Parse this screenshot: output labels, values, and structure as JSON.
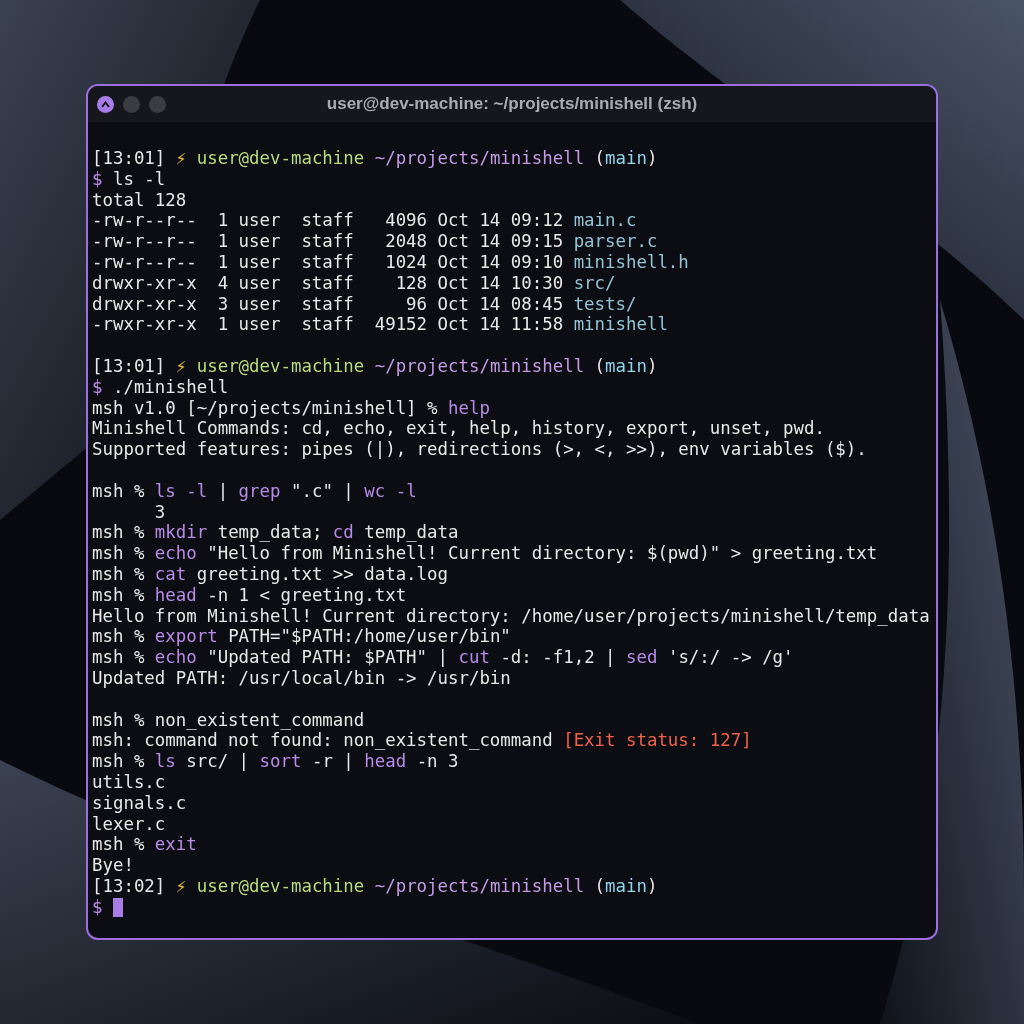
{
  "window": {
    "title": "user@dev-machine: ~/projects/minishell (zsh)"
  },
  "terminal": {
    "cursor_visible": true,
    "lines": [
      {
        "kind": "text",
        "segments": [
          {
            "t": "[13:01] ",
            "kind": "plain"
          },
          {
            "t": "⚡ ",
            "kind": "bolt"
          },
          {
            "t": "user@dev-machine ",
            "kind": "user"
          },
          {
            "t": "~/projects/minishell",
            "kind": "path"
          },
          {
            "t": " (",
            "kind": "plain"
          },
          {
            "t": "main",
            "kind": "branch"
          },
          {
            "t": ")",
            "kind": "plain"
          }
        ]
      },
      {
        "kind": "text",
        "segments": [
          {
            "t": "$ ",
            "kind": "prompt"
          },
          {
            "t": "ls -l",
            "kind": "plain"
          }
        ]
      },
      {
        "kind": "text",
        "segments": [
          {
            "t": "total 128",
            "kind": "plain"
          }
        ]
      },
      {
        "kind": "text",
        "segments": [
          {
            "t": "-rw-r--r--  1 user  staff   4096 Oct 14 09:12 ",
            "kind": "plain"
          },
          {
            "t": "main.c",
            "kind": "file"
          }
        ]
      },
      {
        "kind": "text",
        "segments": [
          {
            "t": "-rw-r--r--  1 user  staff   2048 Oct 14 09:15 ",
            "kind": "plain"
          },
          {
            "t": "parser.c",
            "kind": "file"
          }
        ]
      },
      {
        "kind": "text",
        "segments": [
          {
            "t": "-rw-r--r--  1 user  staff   1024 Oct 14 09:10 ",
            "kind": "plain"
          },
          {
            "t": "minishell.h",
            "kind": "file"
          }
        ]
      },
      {
        "kind": "text",
        "segments": [
          {
            "t": "drwxr-xr-x  4 user  staff    128 Oct 14 10:30 ",
            "kind": "plain"
          },
          {
            "t": "src/",
            "kind": "file"
          }
        ]
      },
      {
        "kind": "text",
        "segments": [
          {
            "t": "drwxr-xr-x  3 user  staff     96 Oct 14 08:45 ",
            "kind": "plain"
          },
          {
            "t": "tests/",
            "kind": "file"
          }
        ]
      },
      {
        "kind": "text",
        "segments": [
          {
            "t": "-rwxr-xr-x  1 user  staff  49152 Oct 14 11:58 ",
            "kind": "plain"
          },
          {
            "t": "minishell",
            "kind": "file"
          }
        ]
      },
      {
        "kind": "blank"
      },
      {
        "kind": "text",
        "segments": [
          {
            "t": "[13:01] ",
            "kind": "plain"
          },
          {
            "t": "⚡ ",
            "kind": "bolt"
          },
          {
            "t": "user@dev-machine ",
            "kind": "user"
          },
          {
            "t": "~/projects/minishell",
            "kind": "path"
          },
          {
            "t": " (",
            "kind": "plain"
          },
          {
            "t": "main",
            "kind": "branch"
          },
          {
            "t": ")",
            "kind": "plain"
          }
        ]
      },
      {
        "kind": "text",
        "segments": [
          {
            "t": "$ ",
            "kind": "prompt"
          },
          {
            "t": "./minishell",
            "kind": "plain"
          }
        ]
      },
      {
        "kind": "text",
        "segments": [
          {
            "t": "msh v1.0 [~/projects/minishell] % ",
            "kind": "plain"
          },
          {
            "t": "help",
            "kind": "cmd"
          }
        ]
      },
      {
        "kind": "text",
        "segments": [
          {
            "t": "Minishell Commands: cd, echo, exit, help, history, export, unset, pwd.",
            "kind": "plain"
          }
        ]
      },
      {
        "kind": "text",
        "segments": [
          {
            "t": "Supported features: pipes (|), redirections (>, <, >>), env variables ($).",
            "kind": "plain"
          }
        ]
      },
      {
        "kind": "blank"
      },
      {
        "kind": "text",
        "segments": [
          {
            "t": "msh % ",
            "kind": "plain"
          },
          {
            "t": "ls -l",
            "kind": "cmd"
          },
          {
            "t": " | ",
            "kind": "plain"
          },
          {
            "t": "grep",
            "kind": "cmd"
          },
          {
            "t": " \".c\" | ",
            "kind": "plain"
          },
          {
            "t": "wc -l",
            "kind": "cmd"
          }
        ]
      },
      {
        "kind": "text",
        "segments": [
          {
            "t": "      3",
            "kind": "plain"
          }
        ]
      },
      {
        "kind": "text",
        "segments": [
          {
            "t": "msh % ",
            "kind": "plain"
          },
          {
            "t": "mkdir",
            "kind": "cmd"
          },
          {
            "t": " temp_data; ",
            "kind": "plain"
          },
          {
            "t": "cd",
            "kind": "cmd"
          },
          {
            "t": " temp_data",
            "kind": "plain"
          }
        ]
      },
      {
        "kind": "text",
        "segments": [
          {
            "t": "msh % ",
            "kind": "plain"
          },
          {
            "t": "echo",
            "kind": "cmd"
          },
          {
            "t": " \"Hello from Minishell! Current directory: $(pwd)\" > greeting.txt",
            "kind": "plain"
          }
        ]
      },
      {
        "kind": "text",
        "segments": [
          {
            "t": "msh % ",
            "kind": "plain"
          },
          {
            "t": "cat",
            "kind": "cmd"
          },
          {
            "t": " greeting.txt >> data.log",
            "kind": "plain"
          }
        ]
      },
      {
        "kind": "text",
        "segments": [
          {
            "t": "msh % ",
            "kind": "plain"
          },
          {
            "t": "head",
            "kind": "cmd"
          },
          {
            "t": " -n 1 < greeting.txt",
            "kind": "plain"
          }
        ]
      },
      {
        "kind": "text",
        "segments": [
          {
            "t": "Hello from Minishell! Current directory: /home/user/projects/minishell/temp_data",
            "kind": "plain"
          }
        ]
      },
      {
        "kind": "text",
        "segments": [
          {
            "t": "msh % ",
            "kind": "plain"
          },
          {
            "t": "export",
            "kind": "cmd"
          },
          {
            "t": " PATH=\"$PATH:/home/user/bin\"",
            "kind": "plain"
          }
        ]
      },
      {
        "kind": "text",
        "segments": [
          {
            "t": "msh % ",
            "kind": "plain"
          },
          {
            "t": "echo",
            "kind": "cmd"
          },
          {
            "t": " \"Updated PATH: $PATH\" | ",
            "kind": "plain"
          },
          {
            "t": "cut",
            "kind": "cmd"
          },
          {
            "t": " -d: -f1,2 | ",
            "kind": "plain"
          },
          {
            "t": "sed",
            "kind": "cmd"
          },
          {
            "t": " 's/:/ -> /g'",
            "kind": "plain"
          }
        ]
      },
      {
        "kind": "text",
        "segments": [
          {
            "t": "Updated PATH: /usr/local/bin -> /usr/bin",
            "kind": "plain"
          }
        ]
      },
      {
        "kind": "blank"
      },
      {
        "kind": "text",
        "segments": [
          {
            "t": "msh % non_existent_command",
            "kind": "plain"
          }
        ]
      },
      {
        "kind": "text",
        "segments": [
          {
            "t": "msh: command not found: non_existent_command ",
            "kind": "plain"
          },
          {
            "t": "[Exit status: 127]",
            "kind": "error"
          }
        ]
      },
      {
        "kind": "text",
        "segments": [
          {
            "t": "msh % ",
            "kind": "plain"
          },
          {
            "t": "ls",
            "kind": "cmd"
          },
          {
            "t": " src/ | ",
            "kind": "plain"
          },
          {
            "t": "sort",
            "kind": "cmd"
          },
          {
            "t": " -r | ",
            "kind": "plain"
          },
          {
            "t": "head",
            "kind": "cmd"
          },
          {
            "t": " -n 3",
            "kind": "plain"
          }
        ]
      },
      {
        "kind": "text",
        "segments": [
          {
            "t": "utils.c",
            "kind": "plain"
          }
        ]
      },
      {
        "kind": "text",
        "segments": [
          {
            "t": "signals.c",
            "kind": "plain"
          }
        ]
      },
      {
        "kind": "text",
        "segments": [
          {
            "t": "lexer.c",
            "kind": "plain"
          }
        ]
      },
      {
        "kind": "text",
        "segments": [
          {
            "t": "msh % ",
            "kind": "plain"
          },
          {
            "t": "exit",
            "kind": "cmd"
          }
        ]
      },
      {
        "kind": "text",
        "segments": [
          {
            "t": "Bye!",
            "kind": "plain"
          }
        ]
      },
      {
        "kind": "text",
        "segments": [
          {
            "t": "[13:02] ",
            "kind": "plain"
          },
          {
            "t": "⚡ ",
            "kind": "bolt"
          },
          {
            "t": "user@dev-machine ",
            "kind": "user"
          },
          {
            "t": "~/projects/minishell",
            "kind": "path"
          },
          {
            "t": " (",
            "kind": "plain"
          },
          {
            "t": "main",
            "kind": "branch"
          },
          {
            "t": ")",
            "kind": "plain"
          }
        ]
      },
      {
        "kind": "text",
        "segments": [
          {
            "t": "$ ",
            "kind": "prompt"
          }
        ]
      }
    ]
  }
}
